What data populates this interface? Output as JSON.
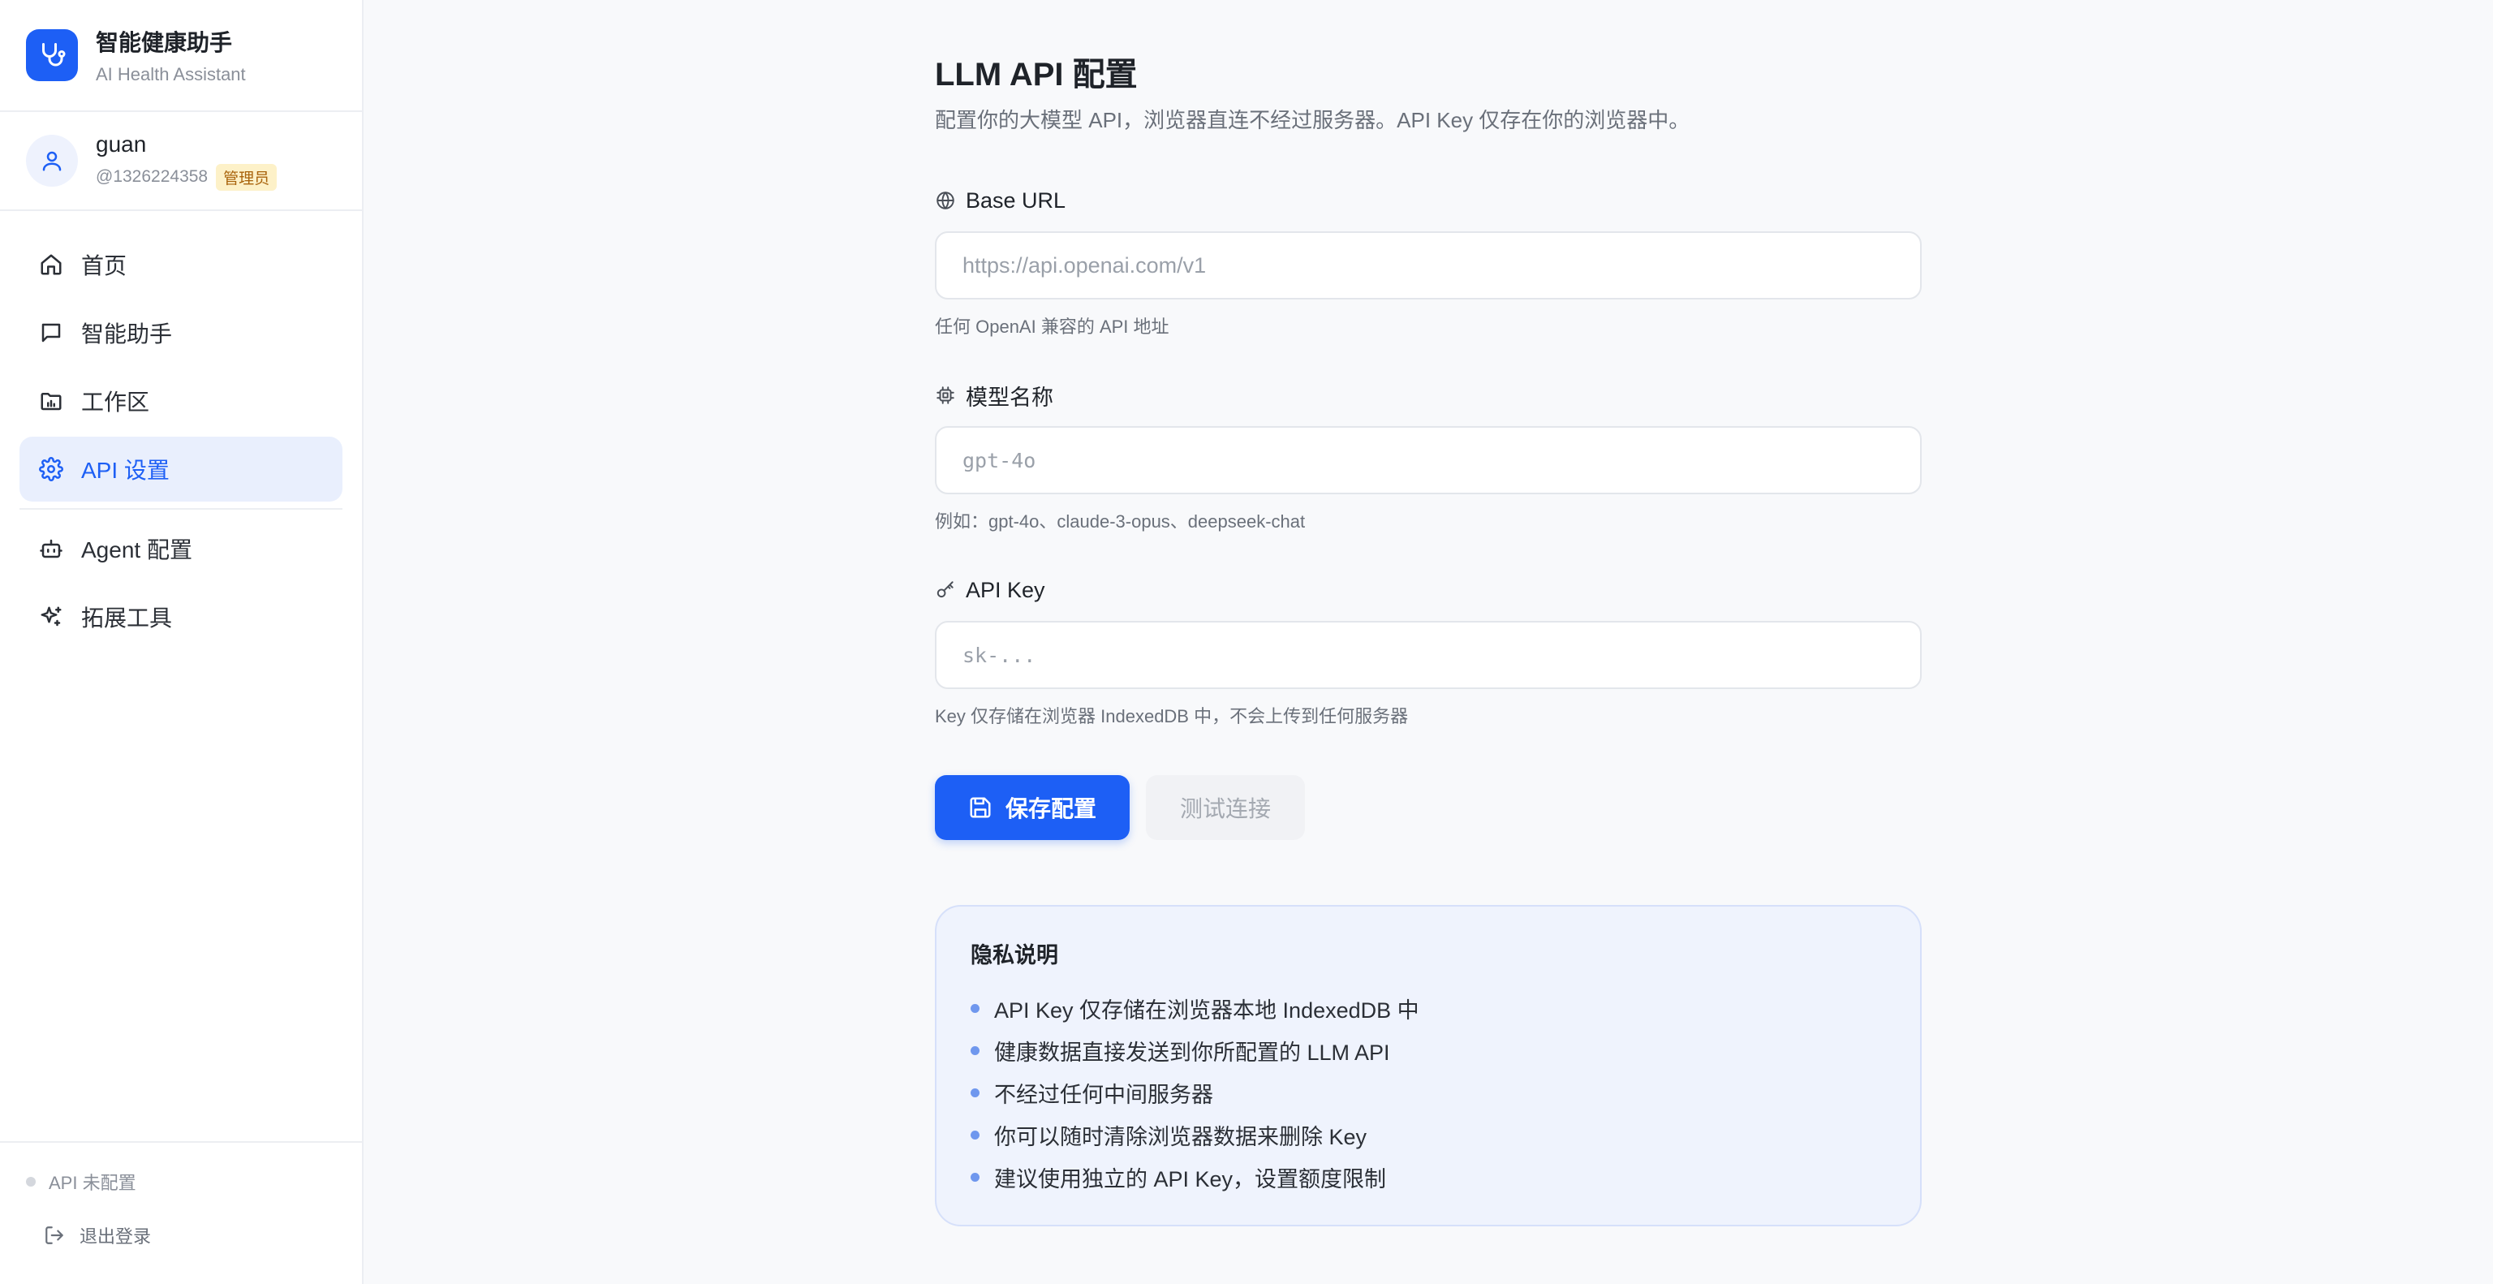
{
  "brand": {
    "title": "智能健康助手",
    "subtitle": "AI Health Assistant",
    "logo_icon": "stethoscope-icon",
    "accent_color": "#1d5ff5"
  },
  "user": {
    "name": "guan",
    "handle": "@1326224358",
    "role_badge": "管理员"
  },
  "nav": {
    "items": [
      {
        "label": "首页",
        "icon": "home-icon"
      },
      {
        "label": "智能助手",
        "icon": "chat-icon"
      },
      {
        "label": "工作区",
        "icon": "folder-chart-icon"
      },
      {
        "label": "API 设置",
        "icon": "gear-icon",
        "active": true
      },
      {
        "label": "Agent 配置",
        "icon": "bot-icon"
      },
      {
        "label": "拓展工具",
        "icon": "sparkles-icon"
      }
    ]
  },
  "footer": {
    "api_status": "API 未配置",
    "logout": "退出登录"
  },
  "page": {
    "title": "LLM API 配置",
    "description": "配置你的大模型 API，浏览器直连不经过服务器。API Key 仅存在你的浏览器中。"
  },
  "fields": {
    "base_url": {
      "label": "Base URL",
      "placeholder": "https://api.openai.com/v1",
      "value": "",
      "hint": "任何 OpenAI 兼容的 API 地址"
    },
    "model": {
      "label": "模型名称",
      "placeholder": "gpt-4o",
      "value": "",
      "hint": "例如：gpt-4o、claude-3-opus、deepseek-chat"
    },
    "api_key": {
      "label": "API Key",
      "placeholder": "sk-...",
      "value": "",
      "hint": "Key 仅存储在浏览器 IndexedDB 中，不会上传到任何服务器"
    }
  },
  "buttons": {
    "save": "保存配置",
    "test": "测试连接"
  },
  "privacy": {
    "title": "隐私说明",
    "items": [
      "API Key 仅存储在浏览器本地 IndexedDB 中",
      "健康数据直接发送到你所配置的 LLM API",
      "不经过任何中间服务器",
      "你可以随时清除浏览器数据来删除 Key",
      "建议使用独立的 API Key，设置额度限制"
    ]
  }
}
